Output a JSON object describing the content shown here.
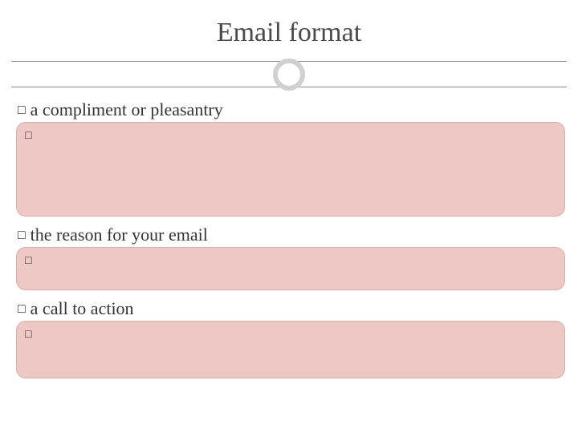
{
  "title": "Email format",
  "bullet_glyph": "□",
  "sections": [
    {
      "heading": "a compliment or pleasantry"
    },
    {
      "heading": "the reason for your email"
    },
    {
      "heading": "a call to action"
    }
  ]
}
